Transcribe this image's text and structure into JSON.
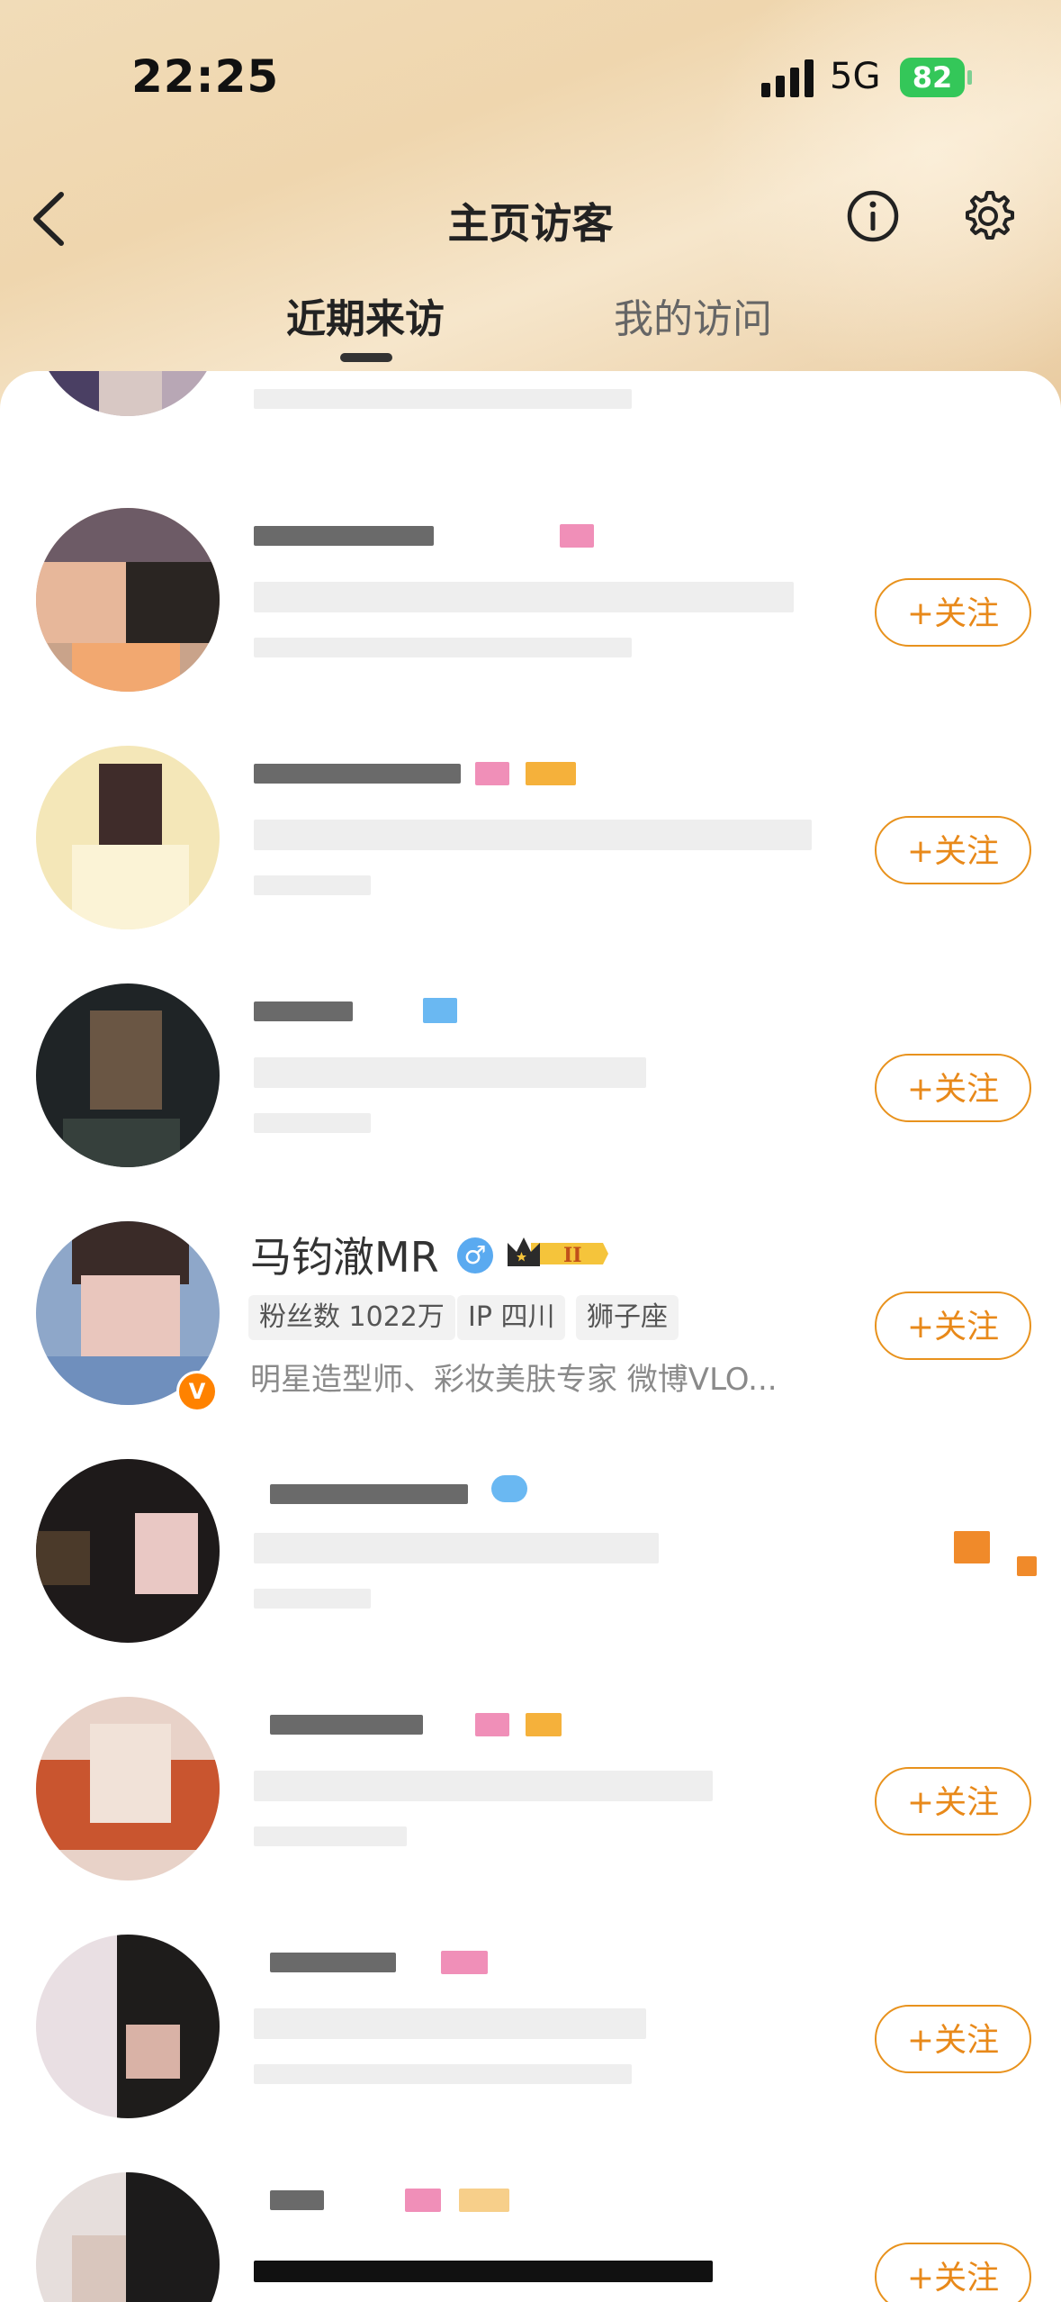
{
  "status_bar": {
    "time": "22:25",
    "network": "5G",
    "battery": "82"
  },
  "header": {
    "title": "主页访客"
  },
  "tabs": [
    {
      "label": "近期来访",
      "active": true
    },
    {
      "label": "我的访问",
      "active": false
    }
  ],
  "follow_label": "+关注",
  "featured_user": {
    "name": "马钧澈MR",
    "gender": "male",
    "vip_level": "II",
    "verified_badge": "V",
    "tags": [
      "粉丝数 1022万",
      "IP 四川",
      "狮子座"
    ],
    "bio": "明星造型师、彩妆美肤专家 微博VLO..."
  },
  "colors": {
    "accent": "#e8891a",
    "verified": "#ff8200",
    "gender": "#5aaaf0"
  }
}
